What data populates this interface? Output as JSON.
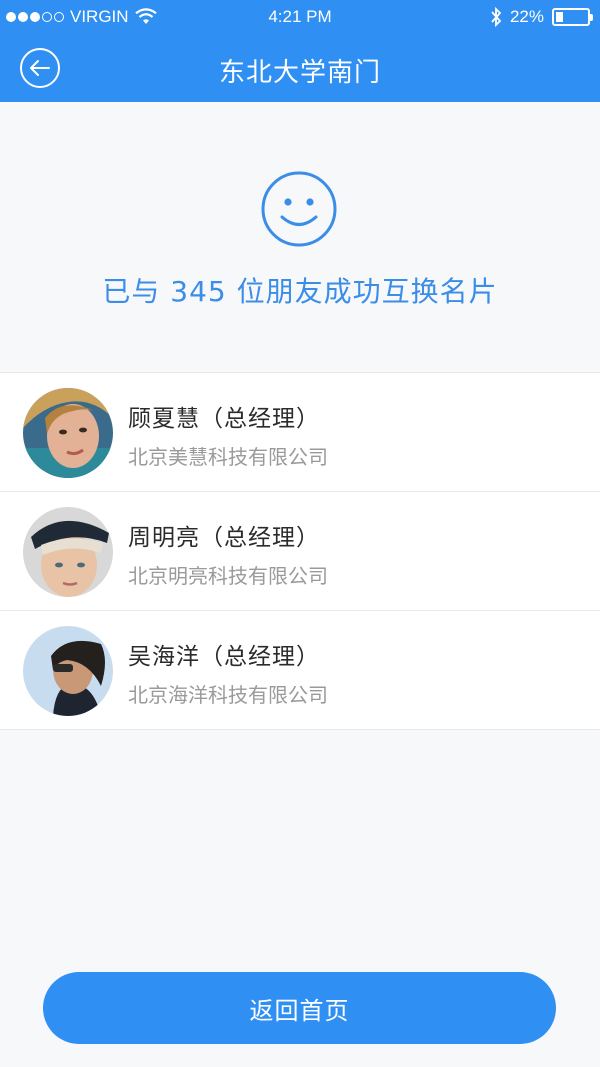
{
  "status_bar": {
    "carrier": "VIRGIN",
    "time": "4:21 PM",
    "battery_percent": "22%",
    "battery_level": 0.22,
    "signal_bars_filled": 3,
    "signal_bars_total": 5
  },
  "nav": {
    "title": "东北大学南门",
    "back_icon": "back-arrow-circle-icon"
  },
  "success": {
    "icon": "smile-icon",
    "message": "已与 345 位朋友成功互换名片"
  },
  "contacts": [
    {
      "name": "顾夏慧（总经理）",
      "company": "北京美慧科技有限公司",
      "avatar": "avatar-woman"
    },
    {
      "name": "周明亮（总经理）",
      "company": "北京明亮科技有限公司",
      "avatar": "avatar-boy"
    },
    {
      "name": "吴海洋（总经理）",
      "company": "北京海洋科技有限公司",
      "avatar": "avatar-man"
    }
  ],
  "footer": {
    "home_button_label": "返回首页"
  },
  "colors": {
    "primary": "#2f8ff2",
    "accent_text": "#3b8de8",
    "name_text": "#2b2b2b",
    "secondary_text": "#9a9a9a",
    "background": "#f7f8fa"
  }
}
